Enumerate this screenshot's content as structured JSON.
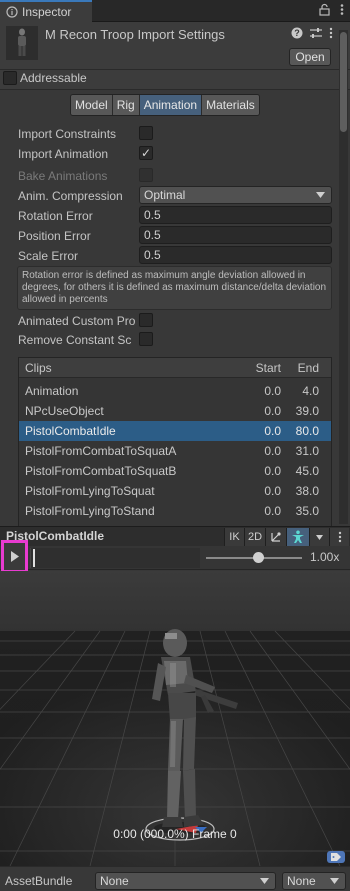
{
  "tab": {
    "title": "Inspector"
  },
  "header": {
    "title": "M Recon Troop Import Settings",
    "open_label": "Open"
  },
  "addressable": {
    "label": "Addressable",
    "checked": false
  },
  "tabs": [
    {
      "label": "Model",
      "active": false
    },
    {
      "label": "Rig",
      "active": false
    },
    {
      "label": "Animation",
      "active": true
    },
    {
      "label": "Materials",
      "active": false
    }
  ],
  "fields": {
    "import_constraints": {
      "label": "Import Constraints",
      "checked": false
    },
    "import_animation": {
      "label": "Import Animation",
      "checked": true,
      "check_glyph": "✓"
    },
    "bake_animations": {
      "label": "Bake Animations",
      "checked": false
    },
    "anim_compression": {
      "label": "Anim. Compression",
      "value": "Optimal"
    },
    "rotation_error": {
      "label": "Rotation Error",
      "value": "0.5"
    },
    "position_error": {
      "label": "Position Error",
      "value": "0.5"
    },
    "scale_error": {
      "label": "Scale Error",
      "value": "0.5"
    },
    "help_text": "Rotation error is defined as maximum angle deviation allowed in degrees, for others it is defined as maximum distance/delta deviation allowed in percents",
    "animated_custom": {
      "label": "Animated Custom Pro",
      "checked": false
    },
    "remove_constant": {
      "label": "Remove Constant Sc",
      "checked": false
    }
  },
  "clips": {
    "headers": {
      "name": "Clips",
      "start": "Start",
      "end": "End"
    },
    "rows": [
      {
        "name": "Animation",
        "start": "0.0",
        "end": "4.0",
        "selected": false
      },
      {
        "name": "NPcUseObject",
        "start": "0.0",
        "end": "39.0",
        "selected": false
      },
      {
        "name": "PistolCombatIdle",
        "start": "0.0",
        "end": "80.0",
        "selected": true
      },
      {
        "name": "PistolFromCombatToSquatA",
        "start": "0.0",
        "end": "31.0",
        "selected": false
      },
      {
        "name": "PistolFromCombatToSquatB",
        "start": "0.0",
        "end": "45.0",
        "selected": false
      },
      {
        "name": "PistolFromLyingToSquat",
        "start": "0.0",
        "end": "38.0",
        "selected": false
      },
      {
        "name": "PistolFromLyingToStand",
        "start": "0.0",
        "end": "35.0",
        "selected": false
      }
    ]
  },
  "preview": {
    "title": "PistolCombatIdle",
    "tools": [
      "IK",
      "2D"
    ],
    "speed": "1.00x",
    "speed_fraction": 0.55,
    "frame_text": "0:00 (000.0%) Frame 0"
  },
  "footer": {
    "label": "AssetBundle",
    "bundle_value": "None",
    "variant_value": "None"
  },
  "icons": {
    "tab": "info-icon",
    "lock": "lock-icon",
    "menu": "kebab-menu-icon",
    "help": "help-icon",
    "settings": "preset-sliders-icon",
    "play": "play-icon",
    "tag": "asset-label-icon"
  },
  "colors": {
    "accent": "#2c5d87",
    "active_tab": "#46607c",
    "highlight": "#e83bd0"
  }
}
